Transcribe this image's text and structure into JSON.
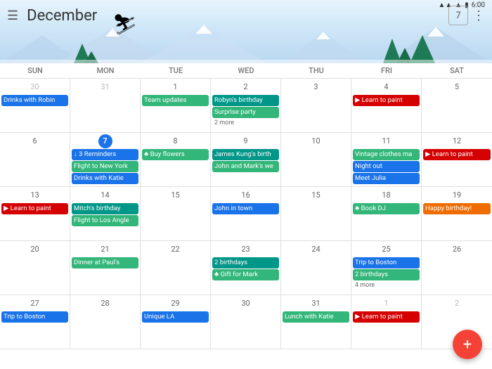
{
  "statusBar": {
    "time": "6:00",
    "battery": "▮▮▮",
    "signal": "▮▮▮"
  },
  "header": {
    "title": "December",
    "menuIcon": "☰",
    "calIcon": "7",
    "moreIcon": "⋮"
  },
  "dayHeaders": [
    "Sun",
    "Mon",
    "Tue",
    "Wed",
    "Thu",
    "Fri",
    "Sat"
  ],
  "weeks": [
    {
      "days": [
        {
          "num": "30",
          "grayed": true,
          "events": [
            {
              "label": "Drinks with Robin",
              "color": "blue"
            }
          ]
        },
        {
          "num": "31",
          "grayed": true,
          "events": []
        },
        {
          "num": "1",
          "events": [
            {
              "label": "Team updates",
              "color": "green"
            }
          ]
        },
        {
          "num": "2",
          "events": [
            {
              "label": "Robyn's birthday",
              "color": "teal"
            },
            {
              "label": "Surprise party",
              "color": "green"
            },
            {
              "label": "2 more",
              "color": "more"
            }
          ]
        },
        {
          "num": "3",
          "events": []
        },
        {
          "num": "4",
          "events": [
            {
              "label": "▶ Learn to paint",
              "color": "red"
            }
          ]
        },
        {
          "num": "5",
          "events": []
        }
      ]
    },
    {
      "days": [
        {
          "num": "6",
          "events": []
        },
        {
          "num": "7",
          "today": true,
          "events": [
            {
              "label": "↓ 3 Reminders",
              "color": "blue"
            },
            {
              "label": "Flight to New York",
              "color": "green"
            },
            {
              "label": "Drinks with Katie",
              "color": "blue"
            }
          ]
        },
        {
          "num": "8",
          "events": [
            {
              "label": "♣ Buy flowers",
              "color": "green"
            }
          ]
        },
        {
          "num": "9",
          "events": [
            {
              "label": "James Kung's birth",
              "color": "teal"
            },
            {
              "label": "John and Mark's we",
              "color": "green"
            }
          ]
        },
        {
          "num": "10",
          "events": []
        },
        {
          "num": "11",
          "events": [
            {
              "label": "Vintage clothes ma",
              "color": "green"
            },
            {
              "label": "Night out",
              "color": "blue"
            },
            {
              "label": "Meet Julia",
              "color": "blue"
            }
          ]
        },
        {
          "num": "12",
          "events": [
            {
              "label": "▶ Learn to paint",
              "color": "red"
            }
          ]
        }
      ]
    },
    {
      "days": [
        {
          "num": "13",
          "events": [
            {
              "label": "▶ Learn to paint",
              "color": "red"
            }
          ]
        },
        {
          "num": "14",
          "events": [
            {
              "label": "Mitch's birthday",
              "color": "teal"
            },
            {
              "label": "Flight to Los Angle",
              "color": "green"
            }
          ]
        },
        {
          "num": "15",
          "events": []
        },
        {
          "num": "16",
          "events": [
            {
              "label": "John in town",
              "color": "blue"
            }
          ]
        },
        {
          "num": "15",
          "events": []
        },
        {
          "num": "18",
          "events": [
            {
              "label": "♣ Book DJ",
              "color": "green"
            }
          ]
        },
        {
          "num": "19",
          "events": [
            {
              "label": "Happy birthday!",
              "color": "orange"
            }
          ]
        }
      ]
    },
    {
      "days": [
        {
          "num": "20",
          "events": []
        },
        {
          "num": "21",
          "events": [
            {
              "label": "Dinner at Paul's",
              "color": "green"
            }
          ]
        },
        {
          "num": "22",
          "events": []
        },
        {
          "num": "23",
          "events": [
            {
              "label": "2 birthdays",
              "color": "teal"
            },
            {
              "label": "♣ Gift for Mark",
              "color": "green"
            }
          ]
        },
        {
          "num": "24",
          "events": []
        },
        {
          "num": "25",
          "events": [
            {
              "label": "Trip to Boston",
              "color": "blue"
            },
            {
              "label": "2 birthdays",
              "color": "green"
            },
            {
              "label": "4 more",
              "color": "more"
            }
          ]
        },
        {
          "num": "26",
          "events": []
        }
      ]
    },
    {
      "days": [
        {
          "num": "27",
          "events": [
            {
              "label": "Trip to Boston",
              "color": "blue"
            }
          ]
        },
        {
          "num": "28",
          "events": []
        },
        {
          "num": "29",
          "events": [
            {
              "label": "Unique LA",
              "color": "blue"
            }
          ]
        },
        {
          "num": "30",
          "events": []
        },
        {
          "num": "31",
          "events": [
            {
              "label": "Lunch with Katie",
              "color": "green"
            }
          ]
        },
        {
          "num": "1",
          "grayed": true,
          "events": [
            {
              "label": "▶ Learn to paint",
              "color": "red"
            }
          ]
        },
        {
          "num": "2",
          "grayed": true,
          "events": []
        }
      ]
    }
  ],
  "fab": {
    "label": "+"
  }
}
